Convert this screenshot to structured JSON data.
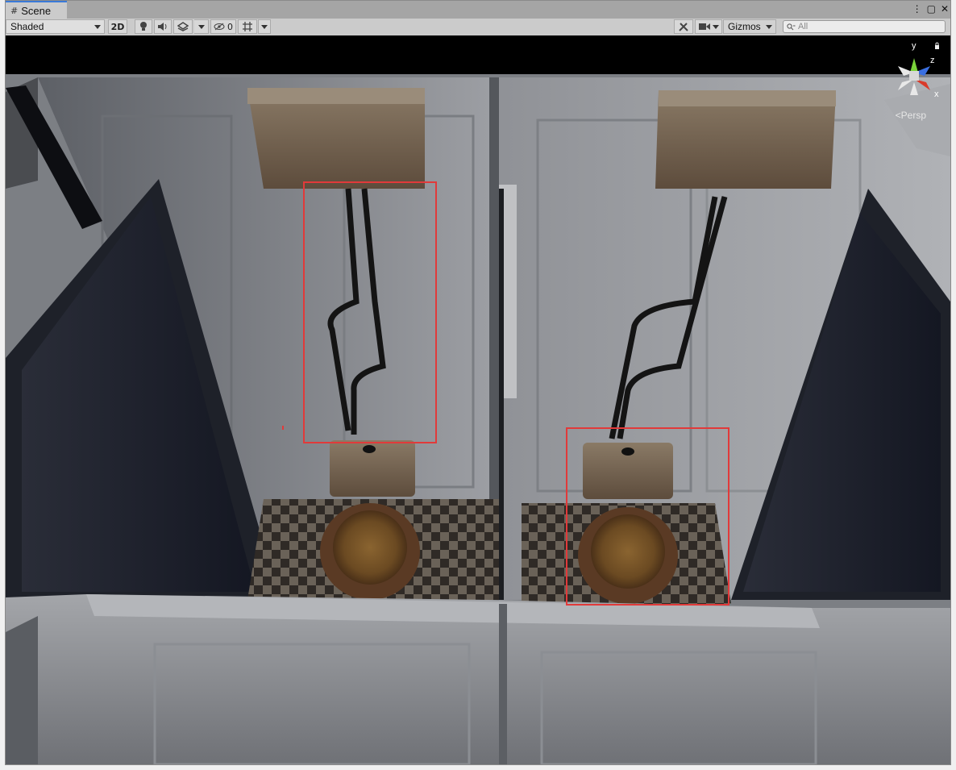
{
  "window": {
    "tab_label": "Scene",
    "tab_icon": "scene-hash-icon",
    "menu_icon": "kebab-menu-icon",
    "maximize_icon": "maximize-icon",
    "close_icon": "close-icon"
  },
  "toolbar": {
    "draw_mode": "Shaded",
    "toggle_2d": "2D",
    "hidden_count": "0",
    "gizmos_label": "Gizmos",
    "search_placeholder": "All",
    "icons": [
      "light-bulb-icon",
      "audio-icon",
      "effects-icon",
      "visibility-icon",
      "grid-snap-icon",
      "tools-icon",
      "camera-icon"
    ]
  },
  "viewport": {
    "projection_label": "Persp",
    "axis_labels": {
      "x": "x",
      "y": "y",
      "z": "z"
    },
    "highlight_color": "#e13a3a",
    "scene_description_colors": {
      "wall": "#8a8c90",
      "tank": "#6b5a4a",
      "bowl": "#7a5a38",
      "floor_dark": "#3a3530"
    }
  }
}
